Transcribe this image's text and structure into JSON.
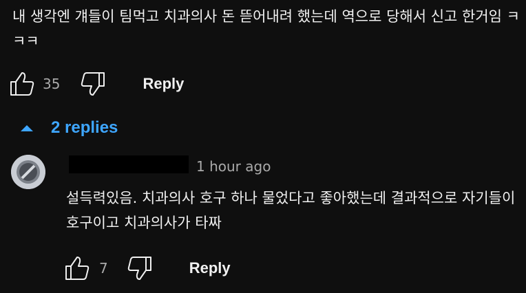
{
  "comment": {
    "text": "내 생각엔 걔들이 팀먹고 치과의사 돈 뜯어내려 했는데 역으로 당해서 신고 한거임 ㅋㅋㅋ",
    "like_count": "35",
    "reply_label": "Reply"
  },
  "replies_toggle": {
    "label": "2 replies",
    "icon": "caret-up-icon",
    "color": "#3ea6ff"
  },
  "reply": {
    "author": "",
    "timestamp": "1 hour ago",
    "text": "설득력있음. 치과의사 호구 하나 물었다고 좋아했는데 결과적으로 자기들이 호구이고 치과의사가 타짜",
    "like_count": "7",
    "reply_label": "Reply"
  },
  "colors": {
    "background": "#0f0f0f",
    "text_primary": "#f1f1f1",
    "text_secondary": "#aaaaaa",
    "link": "#3ea6ff"
  }
}
